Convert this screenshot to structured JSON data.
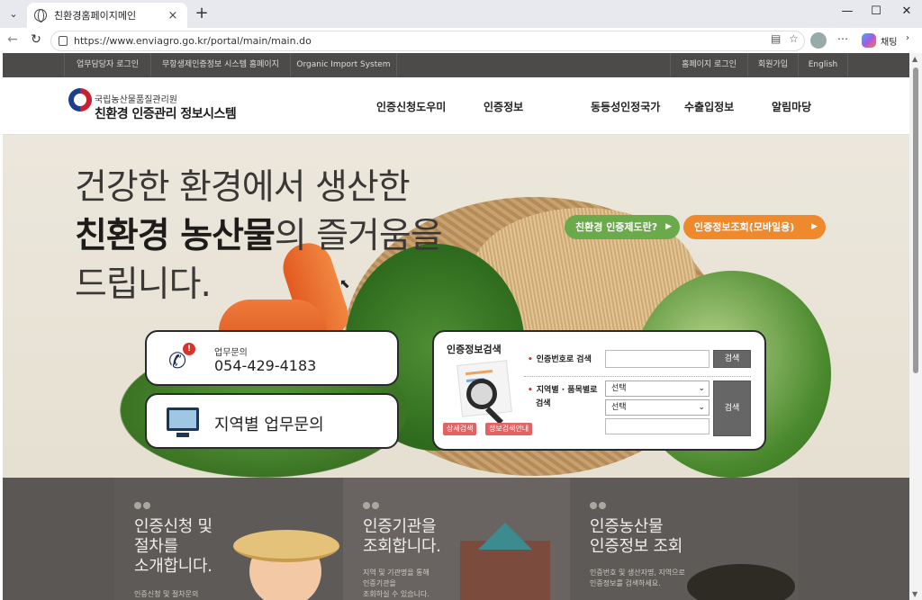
{
  "browser": {
    "tab_title": "친환경홈페이지메인",
    "url": "https://www.enviagro.go.kr/portal/main/main.do",
    "chat_label": "채팅",
    "new_tab_glyph": "+",
    "close_glyph": "×",
    "win_min": "—",
    "win_max": "☐",
    "win_close": "✕"
  },
  "util_nav": {
    "left": [
      "업무담당자 로그인",
      "무항생제인증정보 시스템 홈페이지",
      "Organic Import System"
    ],
    "right": [
      "홈페이지 로그인",
      "회원가입",
      "English"
    ]
  },
  "header": {
    "logo_small": "국립농산물품질관리원",
    "logo_big": "친환경 인증관리 정보시스템",
    "gnb": [
      "인증신청도우미",
      "인증정보",
      "동등성인정국가",
      "수출입정보",
      "알림마당"
    ]
  },
  "hero": {
    "line1": "건강한 환경에서 생산한",
    "line2_bold": "친환경 농산물",
    "line2_rest": "의 즐거움을",
    "line3": "드립니다.",
    "pill_green": "친환경 인증제도란?",
    "pill_orange": "인증정보조회(모바일용)",
    "arrow": "▶"
  },
  "contact": {
    "label": "업무문의",
    "phone": "054-429-4183",
    "alert": "!"
  },
  "region": {
    "label": "지역별 업무문의"
  },
  "search": {
    "title": "인증정보검색",
    "cert_no_label": "인증번호로 검색",
    "cert_no_value": "",
    "search_btn": "검색",
    "region_label_1": "지역별 · 품목별로",
    "region_label_2": "검색",
    "select1": "선택",
    "select2": "선택",
    "text_value": "",
    "btn_detail": "상세검색",
    "btn_guide": "정보검색안내"
  },
  "bottom_cards": [
    {
      "title_1": "인증신청 및",
      "title_2": "절차를",
      "title_3": "소개합니다.",
      "desc": "인증신청 및 절차문의"
    },
    {
      "title_1": "인증기관을",
      "title_2": "조회합니다.",
      "title_3": "",
      "desc_1": "지역 및 기관명을 통해",
      "desc_2": "인증기관을",
      "desc_3": "조회하실 수 있습니다."
    },
    {
      "title_1": "인증농산물",
      "title_2": "인증정보 조회",
      "title_3": "",
      "desc_1": "인증번호 및 생산자명, 지역으로",
      "desc_2": "인증정보를 검색하세요."
    }
  ],
  "colors": {
    "util_bar": "#4d4b49",
    "pill_green": "#6aaa4b",
    "pill_orange": "#ee8a2d",
    "bottom_band": "#5b5755",
    "mini_btn": "#e06464"
  }
}
